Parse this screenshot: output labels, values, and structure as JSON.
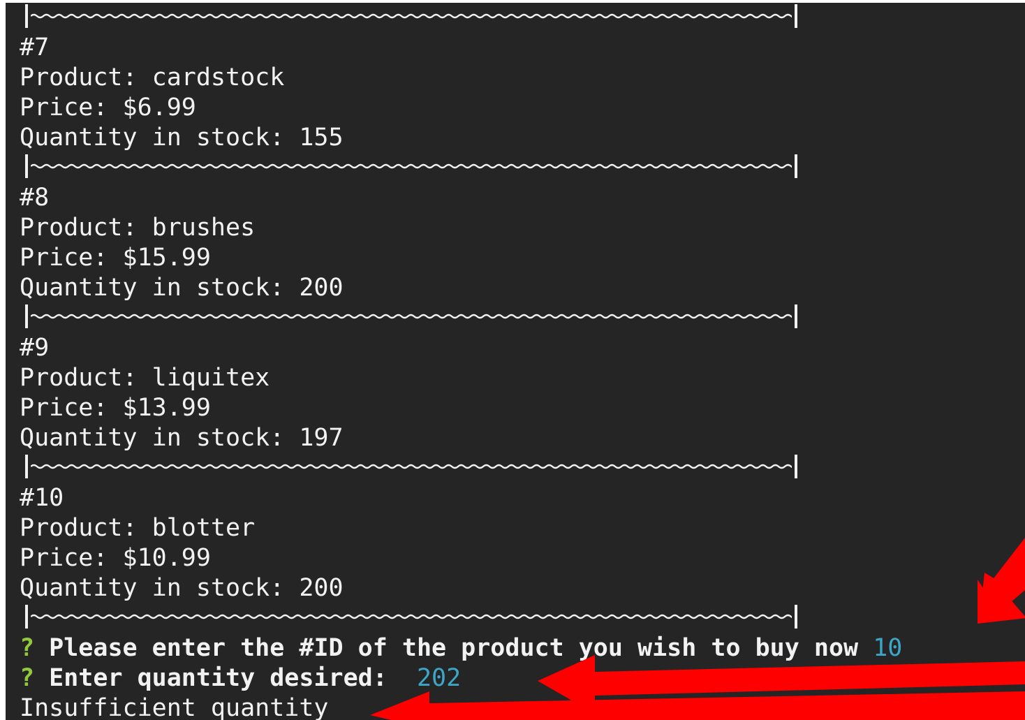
{
  "products": [
    {
      "id": "#7",
      "product": "Product: cardstock",
      "price": "Price: $6.99",
      "quantity": "Quantity in stock: 155"
    },
    {
      "id": "#8",
      "product": "Product: brushes",
      "price": "Price: $15.99",
      "quantity": "Quantity in stock: 200"
    },
    {
      "id": "#9",
      "product": "Product: liquitex",
      "price": "Price: $13.99",
      "quantity": "Quantity in stock: 197"
    },
    {
      "id": "#10",
      "product": "Product: blotter",
      "price": "Price: $10.99",
      "quantity": "Quantity in stock: 200"
    }
  ],
  "prompts": {
    "marker": "?",
    "id_question": "Please enter the #ID of the product you wish to buy now",
    "id_answer": "10",
    "qty_question": "Enter quantity desired:",
    "qty_answer": "202"
  },
  "message": "Insufficient quantity",
  "colors": {
    "background": "#252525",
    "text": "#f2f2f2",
    "question_mark": "#93c83e",
    "answer": "#3ca6c7",
    "annotation_arrows": "#ff0000"
  }
}
